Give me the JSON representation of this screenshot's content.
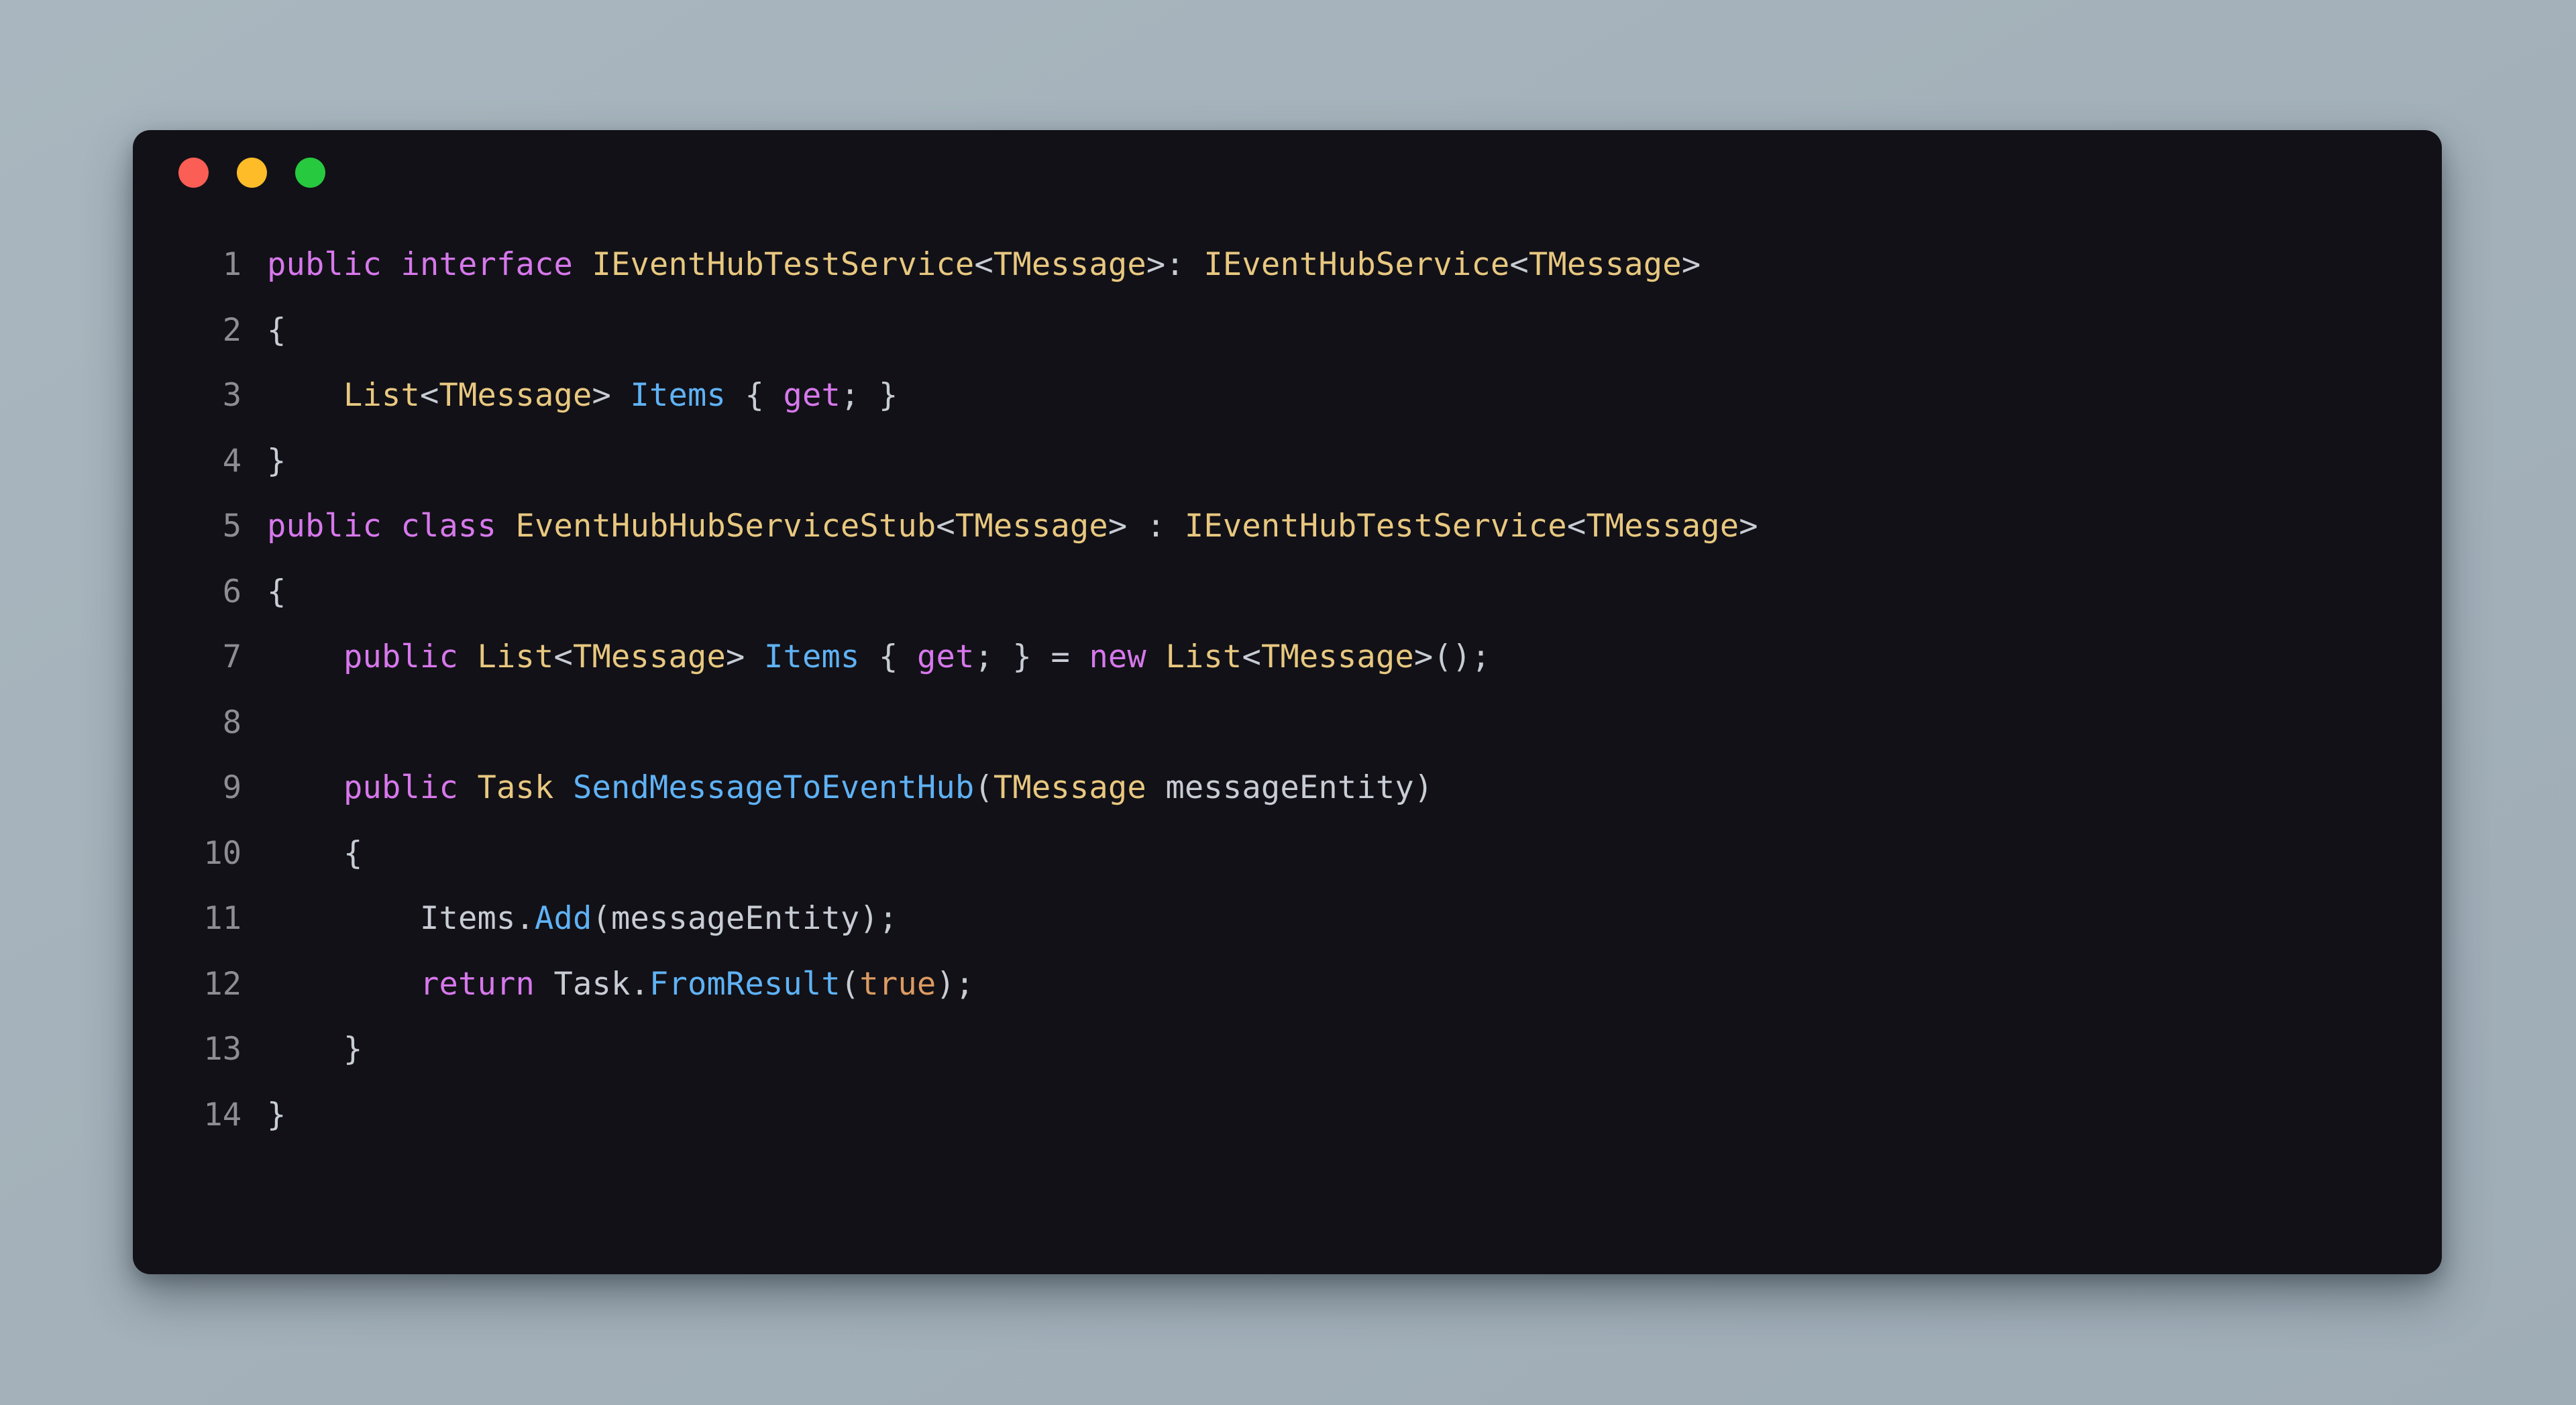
{
  "window": {
    "kind": "code-snippet-window",
    "background_color": "#121117",
    "backdrop_color": "#a7b4bd",
    "traffic_lights": [
      {
        "name": "close",
        "color": "#fa5e55"
      },
      {
        "name": "minimize",
        "color": "#fdbc28"
      },
      {
        "name": "maximize",
        "color": "#27c93f"
      }
    ]
  },
  "theme": {
    "keyword": "#d778ec",
    "type": "#e8c880",
    "function": "#5fb2f5",
    "property": "#5fb2f5",
    "plain": "#c8ccd4",
    "number_literal": "#dc9b62",
    "line_number": "#8d8d93"
  },
  "code": {
    "language": "csharp",
    "line_count": 14,
    "lines": [
      {
        "number": "1",
        "text": "public interface IEventHubTestService<TMessage>: IEventHubService<TMessage>",
        "tokens": [
          {
            "t": "public",
            "c": "kw"
          },
          {
            "t": " ",
            "c": "plain"
          },
          {
            "t": "interface",
            "c": "kw"
          },
          {
            "t": " ",
            "c": "plain"
          },
          {
            "t": "IEventHubTestService",
            "c": "type"
          },
          {
            "t": "<",
            "c": "punct"
          },
          {
            "t": "TMessage",
            "c": "type"
          },
          {
            "t": ">: ",
            "c": "punct"
          },
          {
            "t": "IEventHubService",
            "c": "type"
          },
          {
            "t": "<",
            "c": "punct"
          },
          {
            "t": "TMessage",
            "c": "type"
          },
          {
            "t": ">",
            "c": "punct"
          }
        ]
      },
      {
        "number": "2",
        "text": "{",
        "tokens": [
          {
            "t": "{",
            "c": "punct"
          }
        ]
      },
      {
        "number": "3",
        "text": "    List<TMessage> Items { get; }",
        "tokens": [
          {
            "t": "    ",
            "c": "plain"
          },
          {
            "t": "List",
            "c": "type"
          },
          {
            "t": "<",
            "c": "punct"
          },
          {
            "t": "TMessage",
            "c": "type"
          },
          {
            "t": "> ",
            "c": "punct"
          },
          {
            "t": "Items",
            "c": "prop"
          },
          {
            "t": " { ",
            "c": "punct"
          },
          {
            "t": "get",
            "c": "kw"
          },
          {
            "t": "; }",
            "c": "punct"
          }
        ]
      },
      {
        "number": "4",
        "text": "}",
        "tokens": [
          {
            "t": "}",
            "c": "punct"
          }
        ]
      },
      {
        "number": "5",
        "text": "public class EventHubHubServiceStub<TMessage> : IEventHubTestService<TMessage>",
        "tokens": [
          {
            "t": "public",
            "c": "kw"
          },
          {
            "t": " ",
            "c": "plain"
          },
          {
            "t": "class",
            "c": "kw"
          },
          {
            "t": " ",
            "c": "plain"
          },
          {
            "t": "EventHubHubServiceStub",
            "c": "type"
          },
          {
            "t": "<",
            "c": "punct"
          },
          {
            "t": "TMessage",
            "c": "type"
          },
          {
            "t": "> : ",
            "c": "punct"
          },
          {
            "t": "IEventHubTestService",
            "c": "type"
          },
          {
            "t": "<",
            "c": "punct"
          },
          {
            "t": "TMessage",
            "c": "type"
          },
          {
            "t": ">",
            "c": "punct"
          }
        ]
      },
      {
        "number": "6",
        "text": "{",
        "tokens": [
          {
            "t": "{",
            "c": "punct"
          }
        ]
      },
      {
        "number": "7",
        "text": "    public List<TMessage> Items { get; } = new List<TMessage>();",
        "tokens": [
          {
            "t": "    ",
            "c": "plain"
          },
          {
            "t": "public",
            "c": "kw"
          },
          {
            "t": " ",
            "c": "plain"
          },
          {
            "t": "List",
            "c": "type"
          },
          {
            "t": "<",
            "c": "punct"
          },
          {
            "t": "TMessage",
            "c": "type"
          },
          {
            "t": "> ",
            "c": "punct"
          },
          {
            "t": "Items",
            "c": "prop"
          },
          {
            "t": " { ",
            "c": "punct"
          },
          {
            "t": "get",
            "c": "kw"
          },
          {
            "t": "; } = ",
            "c": "punct"
          },
          {
            "t": "new",
            "c": "kw"
          },
          {
            "t": " ",
            "c": "plain"
          },
          {
            "t": "List",
            "c": "type"
          },
          {
            "t": "<",
            "c": "punct"
          },
          {
            "t": "TMessage",
            "c": "type"
          },
          {
            "t": ">();",
            "c": "punct"
          }
        ]
      },
      {
        "number": "8",
        "text": "",
        "tokens": []
      },
      {
        "number": "9",
        "text": "    public Task SendMessageToEventHub(TMessage messageEntity)",
        "tokens": [
          {
            "t": "    ",
            "c": "plain"
          },
          {
            "t": "public",
            "c": "kw"
          },
          {
            "t": " ",
            "c": "plain"
          },
          {
            "t": "Task",
            "c": "type"
          },
          {
            "t": " ",
            "c": "plain"
          },
          {
            "t": "SendMessageToEventHub",
            "c": "fn"
          },
          {
            "t": "(",
            "c": "punct"
          },
          {
            "t": "TMessage",
            "c": "type"
          },
          {
            "t": " messageEntity)",
            "c": "plain"
          }
        ]
      },
      {
        "number": "10",
        "text": "    {",
        "tokens": [
          {
            "t": "    ",
            "c": "plain"
          },
          {
            "t": "{",
            "c": "punct"
          }
        ]
      },
      {
        "number": "11",
        "text": "        Items.Add(messageEntity);",
        "tokens": [
          {
            "t": "        ",
            "c": "plain"
          },
          {
            "t": "Items.",
            "c": "plain"
          },
          {
            "t": "Add",
            "c": "fn"
          },
          {
            "t": "(messageEntity);",
            "c": "plain"
          }
        ]
      },
      {
        "number": "12",
        "text": "        return Task.FromResult(true);",
        "tokens": [
          {
            "t": "        ",
            "c": "plain"
          },
          {
            "t": "return",
            "c": "kw"
          },
          {
            "t": " ",
            "c": "plain"
          },
          {
            "t": "Task.",
            "c": "plain"
          },
          {
            "t": "FromResult",
            "c": "fn"
          },
          {
            "t": "(",
            "c": "punct"
          },
          {
            "t": "true",
            "c": "num"
          },
          {
            "t": ");",
            "c": "punct"
          }
        ]
      },
      {
        "number": "13",
        "text": "    }",
        "tokens": [
          {
            "t": "    ",
            "c": "plain"
          },
          {
            "t": "}",
            "c": "punct"
          }
        ]
      },
      {
        "number": "14",
        "text": "}",
        "tokens": [
          {
            "t": "}",
            "c": "punct"
          }
        ]
      }
    ]
  }
}
